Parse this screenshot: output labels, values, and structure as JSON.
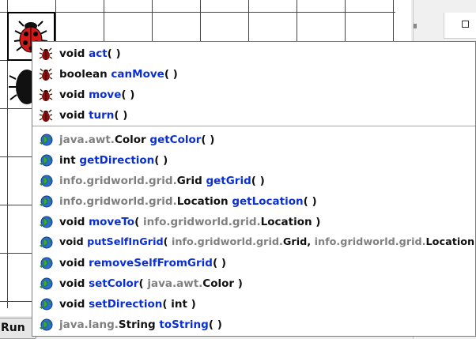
{
  "run_button_label": "Run",
  "bug_methods": [
    [
      {
        "t": "void ",
        "c": "kw"
      },
      {
        "t": "act",
        "c": "nm"
      },
      {
        "t": "( )",
        "c": "kw"
      }
    ],
    [
      {
        "t": "boolean ",
        "c": "kw"
      },
      {
        "t": "canMove",
        "c": "nm"
      },
      {
        "t": "( )",
        "c": "kw"
      }
    ],
    [
      {
        "t": "void ",
        "c": "kw"
      },
      {
        "t": "move",
        "c": "nm"
      },
      {
        "t": "( )",
        "c": "kw"
      }
    ],
    [
      {
        "t": "void ",
        "c": "kw"
      },
      {
        "t": "turn",
        "c": "nm"
      },
      {
        "t": "( )",
        "c": "kw"
      }
    ]
  ],
  "actor_methods": [
    [
      {
        "t": "java.awt.",
        "c": "pk"
      },
      {
        "t": "Color ",
        "c": "kw"
      },
      {
        "t": "getColor",
        "c": "nm"
      },
      {
        "t": "( )",
        "c": "kw"
      }
    ],
    [
      {
        "t": "int ",
        "c": "kw"
      },
      {
        "t": "getDirection",
        "c": "nm"
      },
      {
        "t": "( )",
        "c": "kw"
      }
    ],
    [
      {
        "t": "info.gridworld.grid.",
        "c": "pk"
      },
      {
        "t": "Grid ",
        "c": "kw"
      },
      {
        "t": "getGrid",
        "c": "nm"
      },
      {
        "t": "( )",
        "c": "kw"
      }
    ],
    [
      {
        "t": "info.gridworld.grid.",
        "c": "pk"
      },
      {
        "t": "Location ",
        "c": "kw"
      },
      {
        "t": "getLocation",
        "c": "nm"
      },
      {
        "t": "( )",
        "c": "kw"
      }
    ],
    [
      {
        "t": "void ",
        "c": "kw"
      },
      {
        "t": "moveTo",
        "c": "nm"
      },
      {
        "t": "( ",
        "c": "kw"
      },
      {
        "t": "info.gridworld.grid.",
        "c": "pk"
      },
      {
        "t": "Location )",
        "c": "kw"
      }
    ],
    [
      {
        "t": "void ",
        "c": "kw"
      },
      {
        "t": "putSelfInGrid",
        "c": "nm"
      },
      {
        "t": "( ",
        "c": "kw"
      },
      {
        "t": "info.gridworld.grid.",
        "c": "pk"
      },
      {
        "t": "Grid, ",
        "c": "kw"
      },
      {
        "t": "info.gridworld.grid.",
        "c": "pk"
      },
      {
        "t": "Location )",
        "c": "kw"
      }
    ],
    [
      {
        "t": "void ",
        "c": "kw"
      },
      {
        "t": "removeSelfFromGrid",
        "c": "nm"
      },
      {
        "t": "( )",
        "c": "kw"
      }
    ],
    [
      {
        "t": "void ",
        "c": "kw"
      },
      {
        "t": "setColor",
        "c": "nm"
      },
      {
        "t": "( ",
        "c": "kw"
      },
      {
        "t": "java.awt.",
        "c": "pk"
      },
      {
        "t": "Color )",
        "c": "kw"
      }
    ],
    [
      {
        "t": "void ",
        "c": "kw"
      },
      {
        "t": "setDirection",
        "c": "nm"
      },
      {
        "t": "( int )",
        "c": "kw"
      }
    ],
    [
      {
        "t": "java.lang.",
        "c": "pk"
      },
      {
        "t": "String ",
        "c": "kw"
      },
      {
        "t": "toString",
        "c": "nm"
      },
      {
        "t": "( )",
        "c": "kw"
      }
    ]
  ],
  "icons": {
    "bug_method": "bug-icon",
    "actor_method": "actor-globe-icon"
  },
  "colors": {
    "method_name": "#0a2fd6",
    "package_prefix": "#808080",
    "separator": "#8fa6c8"
  }
}
